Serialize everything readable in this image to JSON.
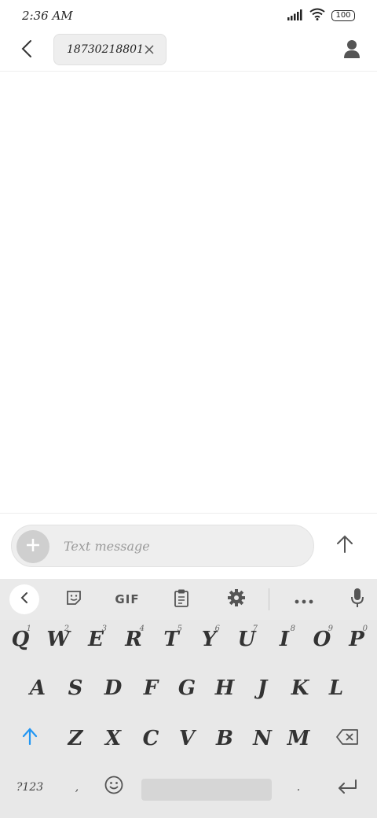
{
  "status_bar": {
    "time": "2:36 AM",
    "battery": "100"
  },
  "header": {
    "recipient": "18730218801"
  },
  "compose": {
    "placeholder": "Text message",
    "value": ""
  },
  "keyboard": {
    "toolbar": {
      "gif_label": "GIF"
    },
    "row1": [
      {
        "label": "Q",
        "hint": "1"
      },
      {
        "label": "W",
        "hint": "2"
      },
      {
        "label": "E",
        "hint": "3"
      },
      {
        "label": "R",
        "hint": "4"
      },
      {
        "label": "T",
        "hint": "5"
      },
      {
        "label": "Y",
        "hint": "6"
      },
      {
        "label": "U",
        "hint": "7"
      },
      {
        "label": "I",
        "hint": "8"
      },
      {
        "label": "O",
        "hint": "9"
      },
      {
        "label": "P",
        "hint": "0"
      }
    ],
    "row2": [
      "A",
      "S",
      "D",
      "F",
      "G",
      "H",
      "J",
      "K",
      "L"
    ],
    "row3": [
      "Z",
      "X",
      "C",
      "V",
      "B",
      "N",
      "M"
    ],
    "row4": {
      "symbols_label": "?123",
      "comma_label": ",",
      "period_label": "."
    }
  },
  "colors": {
    "accent": "#2196f3",
    "keyboard_bg": "#e8e8e8",
    "chip_bg": "#eeeeee"
  }
}
